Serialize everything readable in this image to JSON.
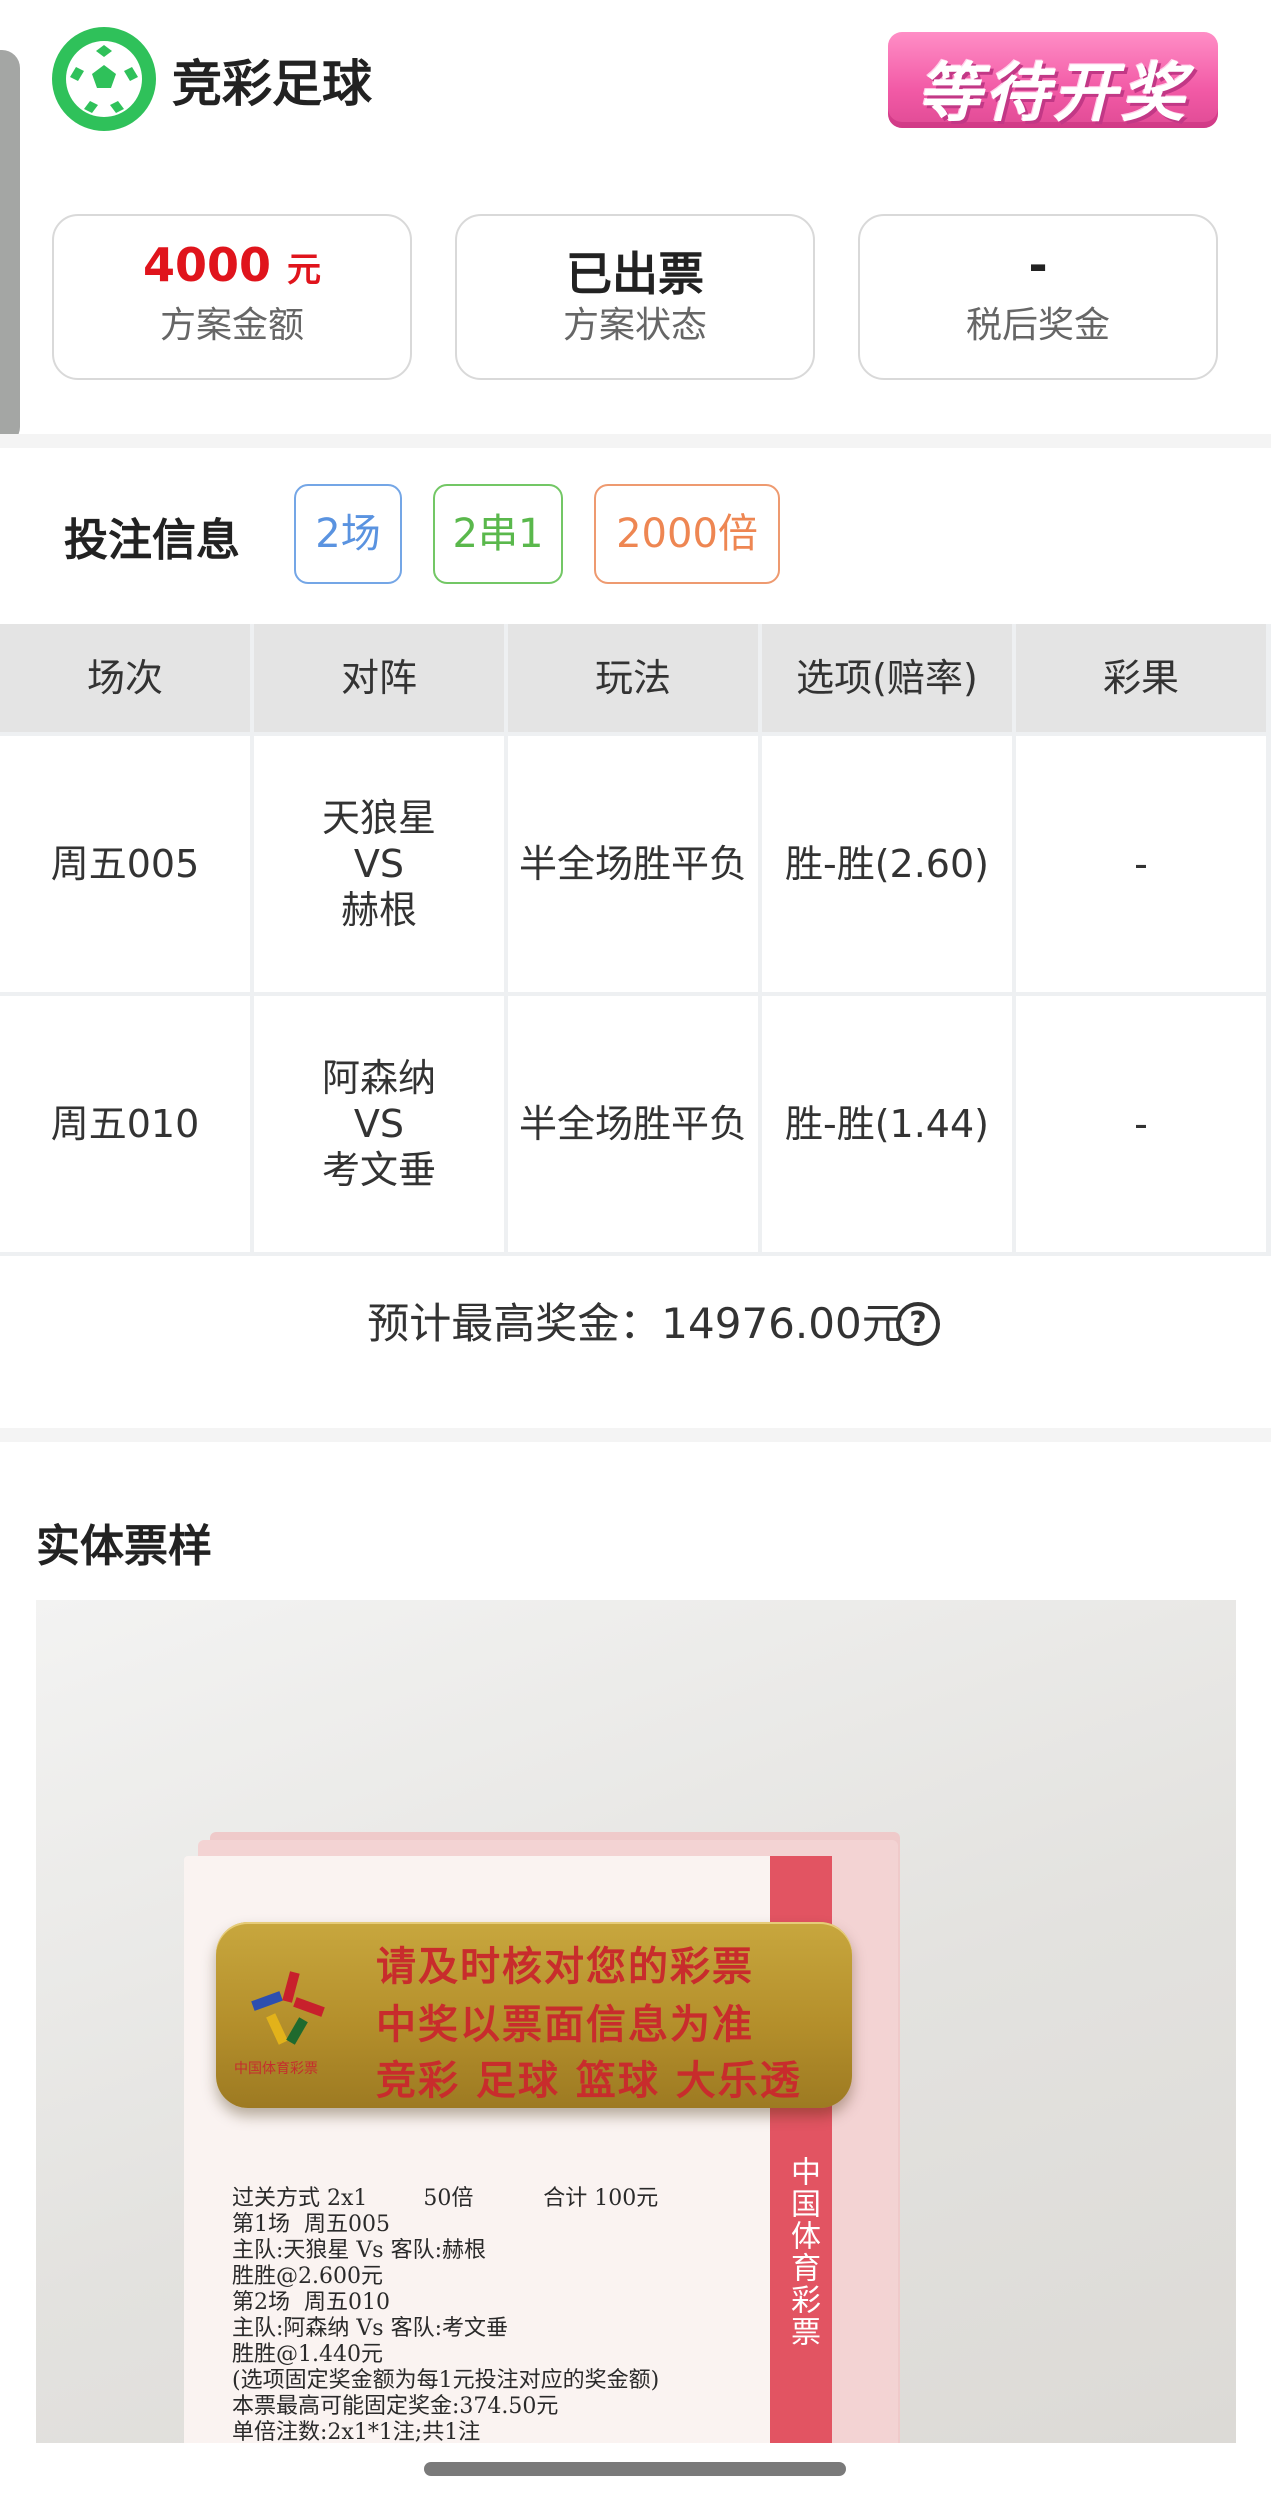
{
  "header": {
    "title": "竞彩足球",
    "status": "等待开奖"
  },
  "summary": {
    "amount_value": "4000",
    "amount_unit": "元",
    "amount_label": "方案金额",
    "status_value": "已出票",
    "status_label": "方案状态",
    "prize_value": "-",
    "prize_label": "税后奖金",
    "accent_color": "#e0141c"
  },
  "bet_info": {
    "title": "投注信息",
    "tags": [
      "2场",
      "2串1",
      "2000倍"
    ]
  },
  "table": {
    "headers": [
      "场次",
      "对阵",
      "玩法",
      "选项(赔率)",
      "彩果"
    ],
    "rows": [
      {
        "match": "周五005",
        "home": "天狼星",
        "vs": "VS",
        "away": "赫根",
        "play": "半全场胜平负",
        "option": "胜-胜(2.60)",
        "result": "-"
      },
      {
        "match": "周五010",
        "home": "阿森纳",
        "vs": "VS",
        "away": "考文垂",
        "play": "半全场胜平负",
        "option": "胜-胜(1.44)",
        "result": "-"
      }
    ]
  },
  "estimate": {
    "text": "预计最高奖金：14976.00元",
    "help_icon": "question-circle-icon"
  },
  "sample": {
    "title": "实体票样",
    "plate_lines": [
      "请及时核对您的彩票",
      "中奖以票面信息为准",
      "竞彩 足球 篮球 大乐透"
    ],
    "plate_org": "中国体育彩票",
    "stripe_text": "中国体育彩票",
    "ticket_lines": [
      "过关方式 2x1        50倍          合计 100元",
      "第1场  周五005",
      "主队:天狼星 Vs 客队:赫根",
      "胜胜@2.600元",
      "第2场  周五010",
      "主队:阿森纳 Vs 客队:考文垂",
      "胜胜@1.440元",
      "(选项固定奖金额为每1元投注对应的奖金额)",
      "本票最高可能固定奖金:374.50元",
      "单倍注数:2x1*1注;共1注",
      " *  *  *"
    ]
  }
}
